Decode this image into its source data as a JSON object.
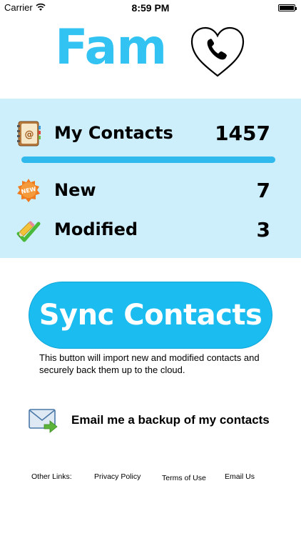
{
  "status_bar": {
    "carrier": "Carrier",
    "time": "8:59 PM"
  },
  "header": {
    "title": "Fam",
    "logo_icon": "phone-heart-icon"
  },
  "contacts": {
    "my_contacts": {
      "label": "My Contacts",
      "count": "1457",
      "icon": "address-book-icon"
    },
    "new": {
      "label": "New",
      "count": "7",
      "icon": "new-badge-icon"
    },
    "modified": {
      "label": "Modified",
      "count": "3",
      "icon": "pencil-check-icon"
    }
  },
  "sync": {
    "button_label": "Sync Contacts",
    "description": "This button will import new and modified contacts and securely back them up to the cloud."
  },
  "email_backup": {
    "label": "Email me a backup of my contacts",
    "icon": "email-forward-icon"
  },
  "footer": {
    "other_links_label": "Other Links:",
    "privacy_policy": "Privacy Policy",
    "terms_of_use": "Terms of Use",
    "email_us": "Email Us"
  },
  "colors": {
    "accent": "#33c3f3",
    "panel_bg": "#cdeefb",
    "button": "#1bbcf0"
  }
}
